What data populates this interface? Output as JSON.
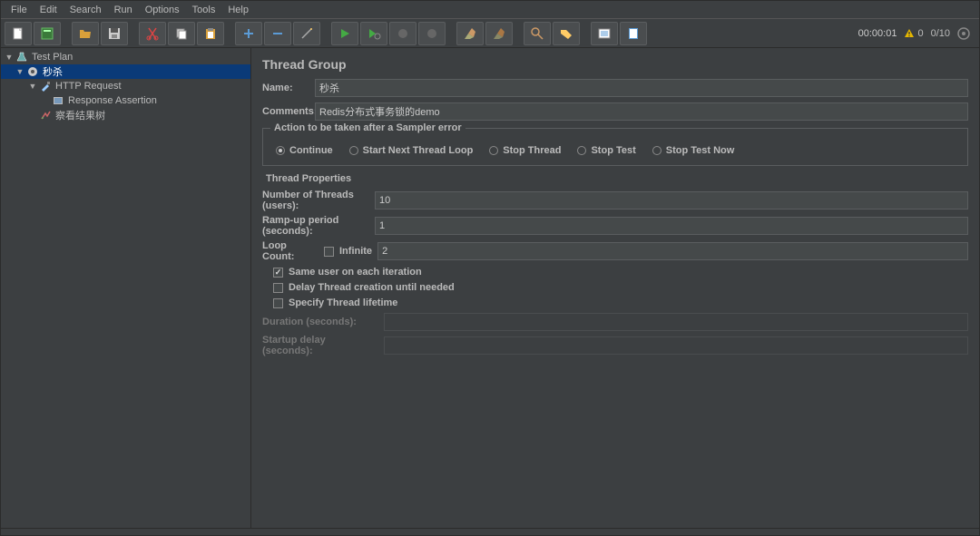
{
  "menu": {
    "file": "File",
    "edit": "Edit",
    "search": "Search",
    "run": "Run",
    "options": "Options",
    "tools": "Tools",
    "help": "Help"
  },
  "toolbar_status": {
    "timer": "00:00:01",
    "warnings": "0",
    "active_threads": "0/10"
  },
  "tree": {
    "root": "Test Plan",
    "thread_group": "秒杀",
    "http_request": "HTTP Request",
    "response_assertion": "Response Assertion",
    "view_results": "察看结果树"
  },
  "panel": {
    "title": "Thread Group",
    "name_label": "Name:",
    "name_value": "秒杀",
    "comments_label": "Comments:",
    "comments_value": "Redis分布式事务锁的demo",
    "sampler_error": {
      "legend": "Action to be taken after a Sampler error",
      "continue": "Continue",
      "start_next": "Start Next Thread Loop",
      "stop_thread": "Stop Thread",
      "stop_test": "Stop Test",
      "stop_test_now": "Stop Test Now"
    },
    "thread_props": {
      "title": "Thread Properties",
      "num_threads_label": "Number of Threads (users):",
      "num_threads_value": "10",
      "rampup_label": "Ramp-up period (seconds):",
      "rampup_value": "1",
      "loop_count_label": "Loop Count:",
      "infinite_label": "Infinite",
      "loop_count_value": "2",
      "same_user": "Same user on each iteration",
      "delay_creation": "Delay Thread creation until needed",
      "specify_lifetime": "Specify Thread lifetime",
      "duration_label": "Duration (seconds):",
      "duration_value": "",
      "startup_delay_label": "Startup delay (seconds):",
      "startup_delay_value": ""
    }
  }
}
